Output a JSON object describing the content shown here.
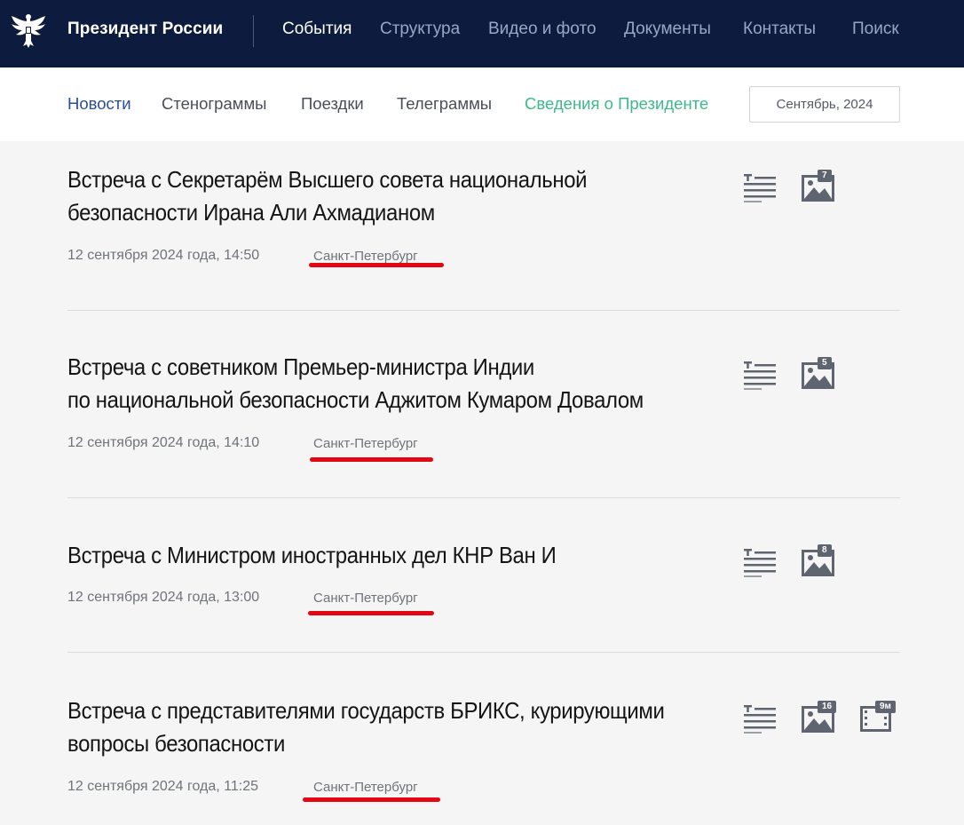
{
  "header": {
    "site_title": "Президент России",
    "nav": [
      {
        "label": "События",
        "active": true
      },
      {
        "label": "Структура"
      },
      {
        "label": "Видео и фото"
      },
      {
        "label": "Документы"
      },
      {
        "label": "Контакты"
      },
      {
        "label": "Поиск"
      }
    ]
  },
  "subnav": {
    "items": [
      {
        "label": "Новости",
        "active": true
      },
      {
        "label": "Стенограммы"
      },
      {
        "label": "Поездки"
      },
      {
        "label": "Телеграммы"
      },
      {
        "label": "Сведения о Президенте",
        "accent": true
      }
    ],
    "date_filter": "Сентябрь, 2024"
  },
  "colors": {
    "header_bg": "#0c1b3e",
    "active_link": "#2a4d9c",
    "accent_green": "#3cb98a",
    "annotation_red": "#e30613"
  },
  "news": [
    {
      "title_lines": [
        "Встреча с Секретарём Высшего совета национальной",
        "безопасности Ирана Али Ахмадианом"
      ],
      "date": "12 сентября 2024 года, 14:50",
      "place": "Санкт-Петербург",
      "icons": [
        "text-icon",
        "photo-icon"
      ],
      "photo_count": "7"
    },
    {
      "title_lines": [
        "Встреча с советником Премьер-министра Индии",
        "по национальной безопасности Аджитом Кумаром Довалом"
      ],
      "date": "12 сентября 2024 года, 14:10",
      "place": "Санкт-Петербург",
      "icons": [
        "text-icon",
        "photo-icon"
      ],
      "photo_count": "5"
    },
    {
      "title_lines": [
        "Встреча с Министром иностранных дел КНР Ван И"
      ],
      "date": "12 сентября 2024 года, 13:00",
      "place": "Санкт-Петербург",
      "icons": [
        "text-icon",
        "photo-icon"
      ],
      "photo_count": "8"
    },
    {
      "title_lines": [
        "Встреча с представителями государств БРИКС, курирующими",
        "вопросы безопасности"
      ],
      "date": "12 сентября 2024 года, 11:25",
      "place": "Санкт-Петербург",
      "icons": [
        "text-icon",
        "photo-icon",
        "video-icon"
      ],
      "photo_count": "16",
      "video_length": "9м"
    }
  ]
}
